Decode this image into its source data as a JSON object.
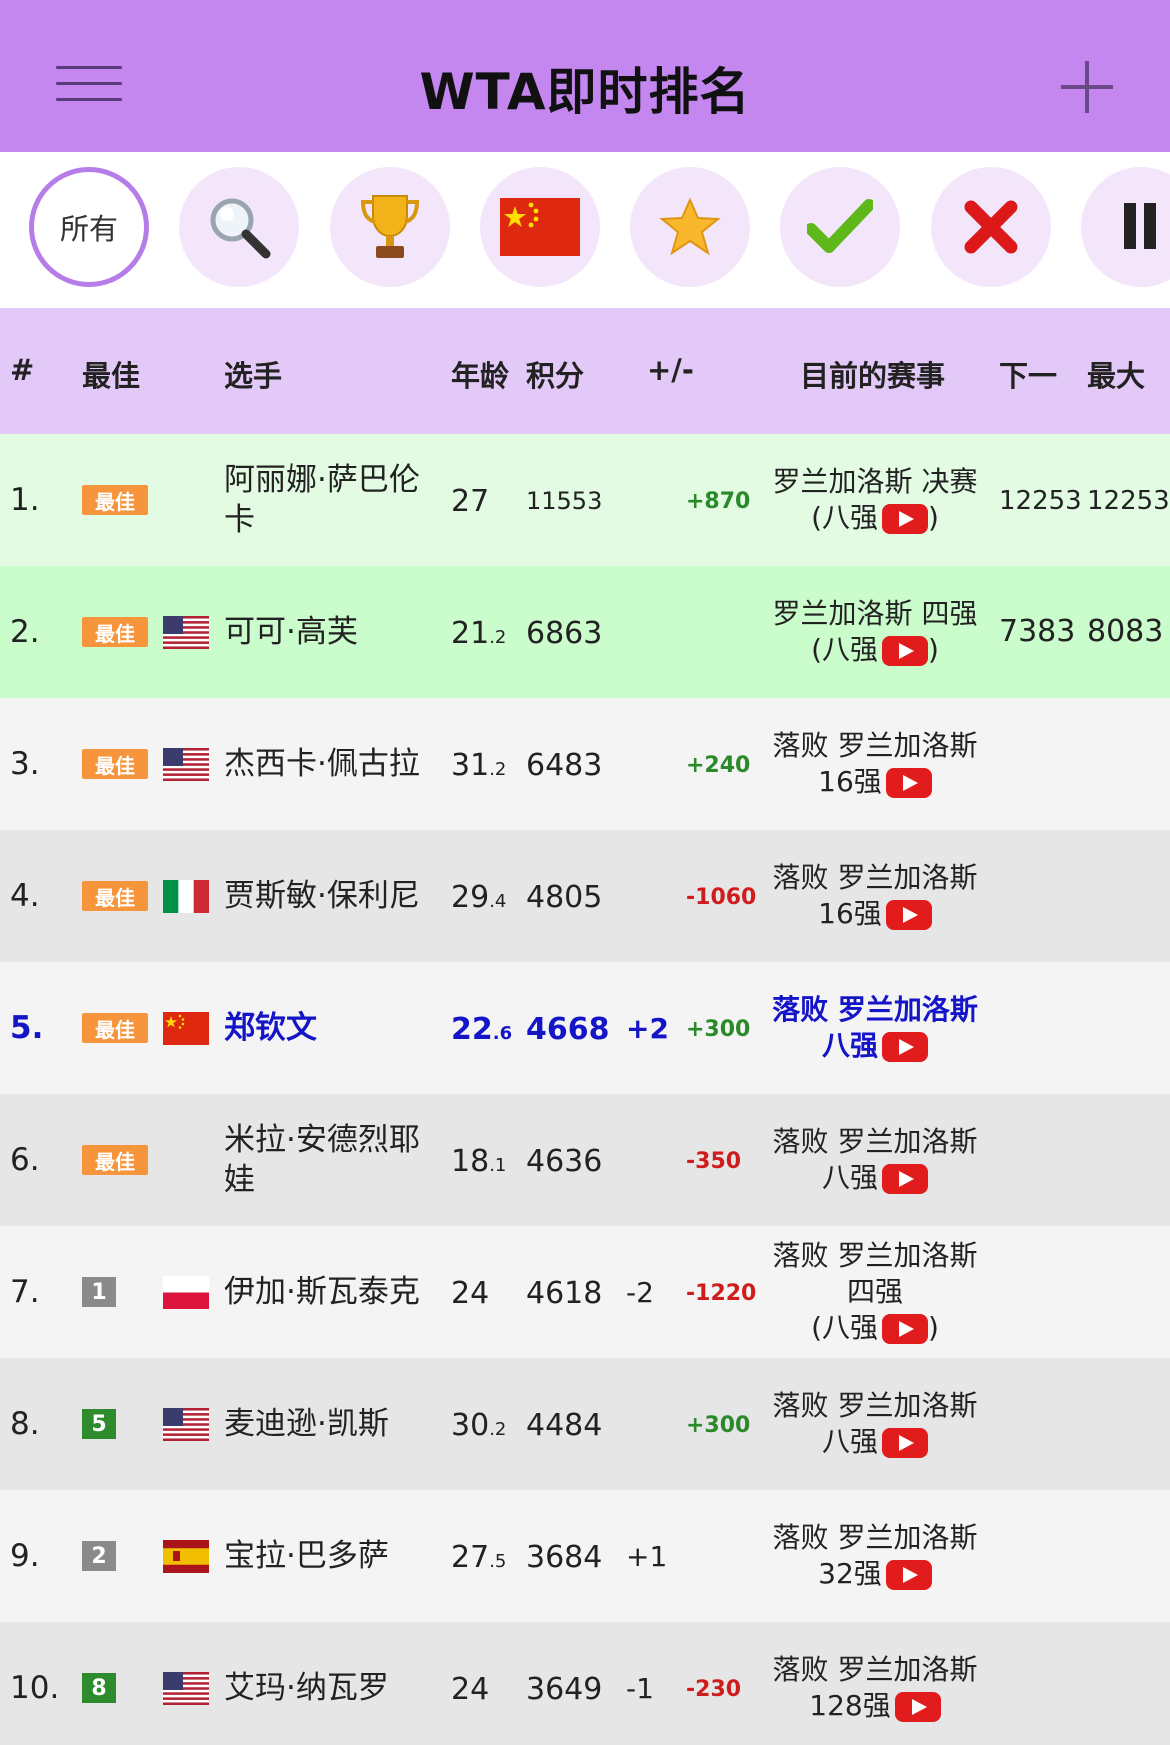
{
  "header": {
    "title": "WTA即时排名"
  },
  "filters": {
    "all_label": "所有"
  },
  "columns": {
    "rank": "#",
    "best": "最佳",
    "player": "选手",
    "age": "年龄",
    "points": "积分",
    "change": "+/-",
    "event": "目前的赛事",
    "next": "下一",
    "max": "最大"
  },
  "rows": [
    {
      "rank": "1.",
      "best": "最佳",
      "flag": "none",
      "name1": "阿丽娜·萨巴伦",
      "name2": "卡",
      "age": "27",
      "age_dec": "",
      "points": "11553",
      "rank_change": "",
      "points_change": "+870",
      "event1": "罗兰加洛斯 决赛",
      "event2": "(八强",
      "event2_after": ")",
      "event3": "",
      "next": "12253",
      "max": "12253",
      "bg": "#e2fbe2"
    },
    {
      "rank": "2.",
      "best": "最佳",
      "flag": "us",
      "name1": "可可·高芙",
      "name2": "",
      "age": "21",
      "age_dec": ".2",
      "points": "6863",
      "rank_change": "",
      "points_change": "",
      "event1": "罗兰加洛斯 四强",
      "event2": "(八强",
      "event2_after": ")",
      "event3": "",
      "next": "7383",
      "max": "8083",
      "bg": "#cbfccb"
    },
    {
      "rank": "3.",
      "best": "最佳",
      "flag": "us",
      "name1": "杰西卡·佩古拉",
      "name2": "",
      "age": "31",
      "age_dec": ".2",
      "points": "6483",
      "rank_change": "",
      "points_change": "+240",
      "event1": "落败 罗兰加洛斯",
      "event2": "16强",
      "event2_after": "",
      "event3": "",
      "next": "",
      "max": "",
      "bg": "#f4f4f4"
    },
    {
      "rank": "4.",
      "best": "最佳",
      "flag": "it",
      "name1": "贾斯敏·保利尼",
      "name2": "",
      "age": "29",
      "age_dec": ".4",
      "points": "4805",
      "rank_change": "",
      "points_change": "-1060",
      "event1": "落败 罗兰加洛斯",
      "event2": "16强",
      "event2_after": "",
      "event3": "",
      "next": "",
      "max": "",
      "bg": "#e6e6e6"
    },
    {
      "rank": "5.",
      "best": "最佳",
      "flag": "cn",
      "name1": "郑钦文",
      "name2": "",
      "age": "22",
      "age_dec": ".6",
      "points": "4668",
      "rank_change": "+2",
      "points_change": "+300",
      "event1": "落败 罗兰加洛斯",
      "event2": "八强",
      "event2_after": "",
      "event3": "",
      "next": "",
      "max": "",
      "bg": "#f4f4f4",
      "highlight": true
    },
    {
      "rank": "6.",
      "best": "最佳",
      "flag": "none",
      "name1": "米拉·安德烈耶",
      "name2": "娃",
      "age": "18",
      "age_dec": ".1",
      "points": "4636",
      "rank_change": "",
      "points_change": "-350",
      "event1": "落败 罗兰加洛斯",
      "event2": "八强",
      "event2_after": "",
      "event3": "",
      "next": "",
      "max": "",
      "bg": "#e6e6e6"
    },
    {
      "rank": "7.",
      "best": "1",
      "best_color": "#8a8a8a",
      "flag": "pl",
      "name1": "伊加·斯瓦泰克",
      "name2": "",
      "age": "24",
      "age_dec": "",
      "points": "4618",
      "rank_change": "-2",
      "points_change": "-1220",
      "event1": "落败 罗兰加洛斯",
      "event2": "四强",
      "event2_after": "",
      "event3": "(八强",
      "next": "",
      "max": "",
      "bg": "#f4f4f4"
    },
    {
      "rank": "8.",
      "best": "5",
      "best_color": "#2e8b2e",
      "flag": "us",
      "name1": "麦迪逊·凯斯",
      "name2": "",
      "age": "30",
      "age_dec": ".2",
      "points": "4484",
      "rank_change": "",
      "points_change": "+300",
      "event1": "落败 罗兰加洛斯",
      "event2": "八强",
      "event2_after": "",
      "event3": "",
      "next": "",
      "max": "",
      "bg": "#e6e6e6"
    },
    {
      "rank": "9.",
      "best": "2",
      "best_color": "#8a8a8a",
      "flag": "es",
      "name1": "宝拉·巴多萨",
      "name2": "",
      "age": "27",
      "age_dec": ".5",
      "points": "3684",
      "rank_change": "+1",
      "points_change": "",
      "event1": "落败 罗兰加洛斯",
      "event2": "32强",
      "event2_after": "",
      "event3": "",
      "next": "",
      "max": "",
      "bg": "#f4f4f4"
    },
    {
      "rank": "10.",
      "best": "8",
      "best_color": "#2e8b2e",
      "flag": "us",
      "name1": "艾玛·纳瓦罗",
      "name2": "",
      "age": "24",
      "age_dec": "",
      "points": "3649",
      "rank_change": "-1",
      "points_change": "-230",
      "event1": "落败 罗兰加洛斯",
      "event2": "128强",
      "event2_after": "",
      "event3": "",
      "next": "",
      "max": "",
      "bg": "#e6e6e6"
    }
  ]
}
